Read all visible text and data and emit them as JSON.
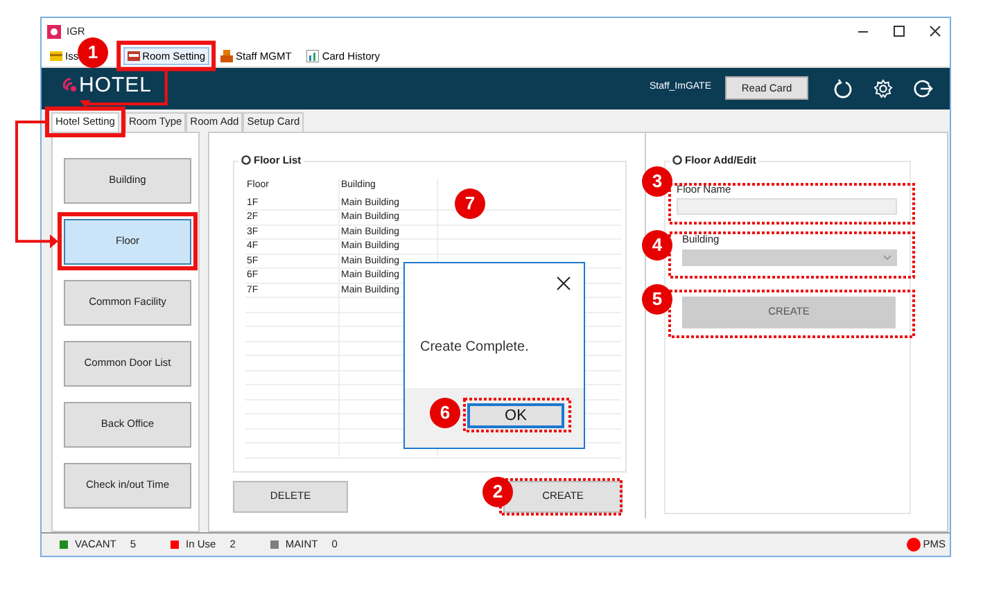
{
  "window": {
    "title": "IGR"
  },
  "toolbar": [
    {
      "label": "Iss",
      "selected": false
    },
    {
      "label": "Room Setting",
      "selected": true
    },
    {
      "label": "Staff MGMT",
      "selected": false
    },
    {
      "label": "Card History",
      "selected": false
    }
  ],
  "header": {
    "logo": "HOTEL",
    "user": "Staff_ImGATE",
    "read_card_button": "Read Card"
  },
  "tabs": [
    {
      "label": "Hotel Setting",
      "selected": true
    },
    {
      "label": "Room Type",
      "selected": false
    },
    {
      "label": "Room Add",
      "selected": false
    },
    {
      "label": "Setup Card",
      "selected": false
    }
  ],
  "side_menu": [
    {
      "label": "Building",
      "selected": false
    },
    {
      "label": "Floor",
      "selected": true
    },
    {
      "label": "Common Facility",
      "selected": false
    },
    {
      "label": "Common Door List",
      "selected": false
    },
    {
      "label": "Back Office",
      "selected": false
    },
    {
      "label": "Check in/out Time",
      "selected": false
    }
  ],
  "floor_list": {
    "title": "Floor List",
    "columns": [
      "Floor",
      "Building"
    ],
    "rows": [
      [
        "1F",
        "Main Building"
      ],
      [
        "2F",
        "Main Building"
      ],
      [
        "3F",
        "Main Building"
      ],
      [
        "4F",
        "Main Building"
      ],
      [
        "5F",
        "Main Building"
      ],
      [
        "6F",
        "Main Building"
      ],
      [
        "7F",
        "Main Building"
      ]
    ],
    "delete_button": "DELETE",
    "create_button": "CREATE"
  },
  "floor_edit": {
    "title": "Floor Add/Edit",
    "floor_name_label": "Floor Name",
    "building_label": "Building",
    "create_button": "CREATE"
  },
  "dialog": {
    "message": "Create Complete.",
    "ok_button": "OK"
  },
  "status_bar": {
    "items": [
      {
        "label": "VACANT",
        "count": "5",
        "color": "#1e8c1e"
      },
      {
        "label": "In Use",
        "count": "2",
        "color": "#ff0000"
      },
      {
        "label": "MAINT",
        "count": "0",
        "color": "#808080"
      }
    ],
    "pms": "PMS"
  },
  "callouts": [
    "1",
    "2",
    "3",
    "4",
    "5",
    "6",
    "7"
  ]
}
